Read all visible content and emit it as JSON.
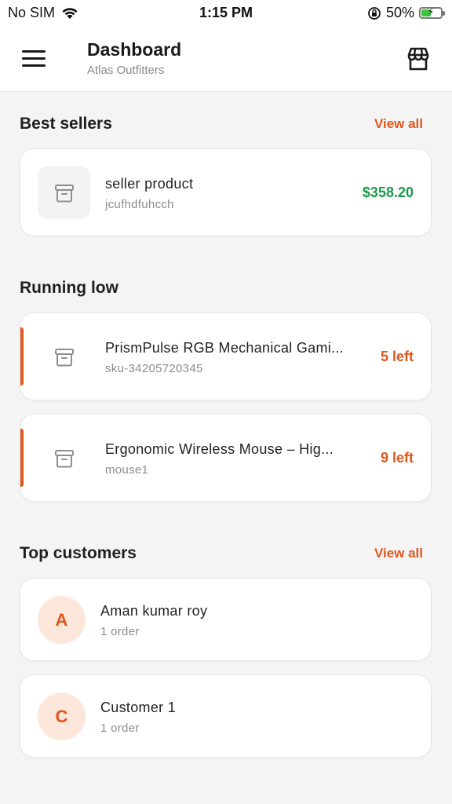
{
  "status_bar": {
    "carrier": "No SIM",
    "time": "1:15 PM",
    "battery_percent": "50%",
    "battery_level": 0.5,
    "icons": [
      "wifi-icon",
      "orientation-lock-icon",
      "battery-charging-icon"
    ]
  },
  "header": {
    "title": "Dashboard",
    "subtitle": "Atlas Outfitters",
    "icons": [
      "menu-icon",
      "store-icon"
    ]
  },
  "best_sellers": {
    "title": "Best sellers",
    "view_all": "View all",
    "items": [
      {
        "name": "seller product",
        "code": "jcufhdfuhcch",
        "price": "$358.20",
        "icon": "archive-box-icon"
      }
    ]
  },
  "running_low": {
    "title": "Running low",
    "items": [
      {
        "name": "PrismPulse RGB Mechanical Gami...",
        "sku": "sku-34205720345",
        "stock": "5 left",
        "icon": "archive-box-icon"
      },
      {
        "name": "Ergonomic Wireless Mouse – Hig...",
        "sku": "mouse1",
        "stock": "9 left",
        "icon": "archive-box-icon"
      }
    ]
  },
  "top_customers": {
    "title": "Top customers",
    "view_all": "View all",
    "items": [
      {
        "initial": "A",
        "name": "Aman kumar roy",
        "orders": "1 order"
      },
      {
        "initial": "C",
        "name": "Customer 1",
        "orders": "1 order"
      }
    ]
  },
  "colors": {
    "accent": "#e0561b",
    "price_green": "#1a9a4a",
    "avatar_bg": "#fde6da",
    "background": "#f4f4f4"
  }
}
